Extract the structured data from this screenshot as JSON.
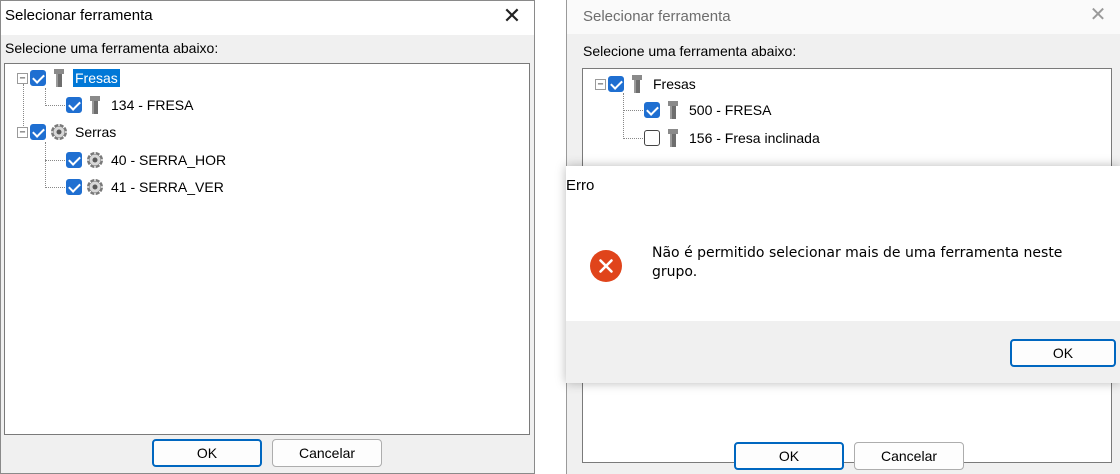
{
  "left_dialog": {
    "title": "Selecionar ferramenta",
    "close_glyph": "✕",
    "prompt": "Selecione uma ferramenta abaixo:",
    "tree": [
      {
        "label": "Fresas",
        "checked": true,
        "icon": "tool-bit-icon",
        "selected": true
      },
      {
        "label": "134 - FRESA",
        "checked": true,
        "icon": "tool-bit-icon"
      },
      {
        "label": "Serras",
        "checked": true,
        "icon": "saw-blade-icon"
      },
      {
        "label": "40 - SERRA_HOR",
        "checked": true,
        "icon": "saw-blade-icon"
      },
      {
        "label": "41 - SERRA_VER",
        "checked": true,
        "icon": "saw-blade-icon"
      }
    ],
    "expander_minus": "−",
    "ok_label": "OK",
    "cancel_label": "Cancelar"
  },
  "right_dialog": {
    "title": "Selecionar ferramenta",
    "close_glyph": "✕",
    "prompt": "Selecione uma ferramenta abaixo:",
    "tree": [
      {
        "label": "Fresas",
        "checked": true,
        "icon": "tool-bit-icon"
      },
      {
        "label": "500 - FRESA",
        "checked": true,
        "icon": "tool-bit-icon"
      },
      {
        "label": "156 - Fresa inclinada",
        "checked": false,
        "icon": "tool-bit-icon"
      }
    ],
    "ok_label": "OK",
    "cancel_label": "Cancelar"
  },
  "error_dialog": {
    "title": "Erro",
    "icon": "error-icon",
    "message": "Não é permitido selecionar mais de uma ferramenta neste grupo.",
    "ok_label": "OK"
  },
  "colors": {
    "checkbox_checked": "#1f6fd1",
    "selection": "#0078d7",
    "error_icon": "#e0441b",
    "default_button_border": "#0067c0"
  }
}
